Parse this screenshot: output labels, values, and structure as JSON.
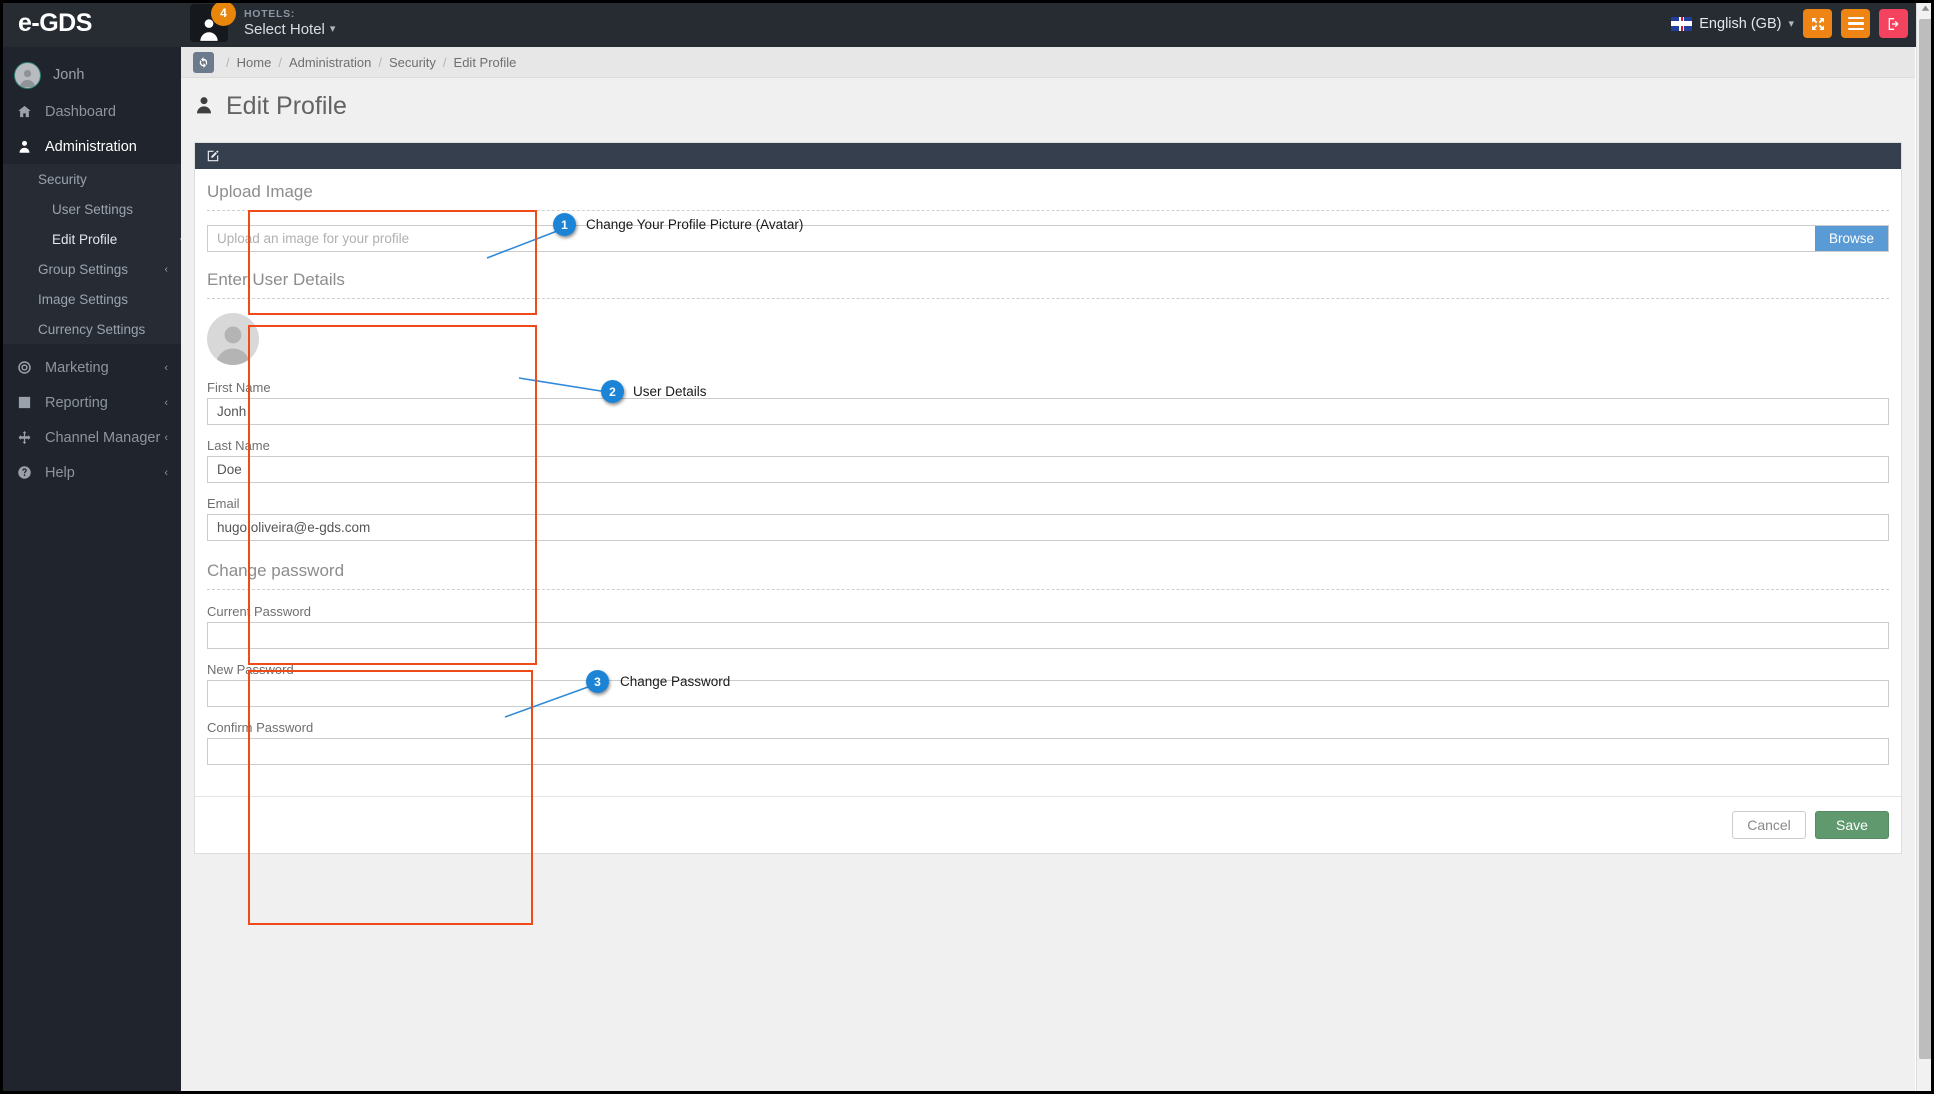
{
  "topbar": {
    "logo": "e-GDS",
    "notification_count": "4",
    "hotels_label": "HOTELS:",
    "hotel_select": "Select Hotel",
    "language": "English (GB)",
    "icons": {
      "hotel_avatar": "user-avatar-icon",
      "flag": "uk-flag-icon",
      "fullscreen": "fullscreen-icon",
      "menu": "hamburger-menu-icon",
      "logout": "logout-icon"
    },
    "colors": {
      "bar_bg": "#272c33",
      "badge": "#e8860c",
      "orange_btn": "#ee8413",
      "red_btn": "#f4435e"
    }
  },
  "sidebar": {
    "user": "Jonh",
    "items": [
      {
        "label": "Dashboard",
        "icon": "home-icon",
        "arrow": ""
      },
      {
        "label": "Administration",
        "icon": "user-icon",
        "arrow": "ⱟ"
      },
      {
        "label": "Marketing",
        "icon": "target-icon",
        "arrow": "‹"
      },
      {
        "label": "Reporting",
        "icon": "bar-chart-icon",
        "arrow": "‹"
      },
      {
        "label": "Channel Manager",
        "icon": "move-arrows-icon",
        "arrow": "‹"
      },
      {
        "label": "Help",
        "icon": "question-circle-icon",
        "arrow": "‹"
      }
    ],
    "submenu": [
      {
        "label": "Security",
        "arrow": "ⱟ",
        "level": 1
      },
      {
        "label": "User Settings",
        "arrow": "",
        "level": 2
      },
      {
        "label": "Edit Profile",
        "arrow": "",
        "level": 2
      },
      {
        "label": "Group Settings",
        "arrow": "‹",
        "level": 1
      },
      {
        "label": "Image Settings",
        "arrow": "",
        "level": 1
      },
      {
        "label": "Currency Settings",
        "arrow": "",
        "level": 1
      }
    ],
    "collapse_icon": "arrow-circle-left-icon"
  },
  "breadcrumb": {
    "refresh_icon": "refresh-icon",
    "items": [
      "Home",
      "Administration",
      "Security",
      "Edit Profile"
    ]
  },
  "page": {
    "title": "Edit Profile",
    "title_icon": "user-icon",
    "panel_icon": "edit-pencil-icon"
  },
  "upload": {
    "section_title": "Upload Image",
    "placeholder": "Upload an image for your profile",
    "value": "",
    "browse_label": "Browse",
    "browse_color": "#5b9bd5"
  },
  "user_details": {
    "section_title": "Enter User Details",
    "avatar_icon": "default-user-avatar-icon",
    "fields": [
      {
        "label": "First Name",
        "value": "Jonh"
      },
      {
        "label": "Last Name",
        "value": "Doe"
      },
      {
        "label": "Email",
        "value": "hugo.oliveira@e-gds.com"
      }
    ]
  },
  "change_password": {
    "section_title": "Change password",
    "fields": [
      {
        "label": "Current Password",
        "value": ""
      },
      {
        "label": "New Password",
        "value": ""
      },
      {
        "label": "Confirm Password",
        "value": ""
      }
    ]
  },
  "footer": {
    "cancel_label": "Cancel",
    "save_label": "Save",
    "save_color": "#60996e"
  },
  "annotations": [
    {
      "number": "1",
      "text": "Change Your Profile Picture (Avatar)"
    },
    {
      "number": "2",
      "text": "User Details"
    },
    {
      "number": "3",
      "text": "Change Password"
    }
  ],
  "annotation_colors": {
    "box": "#ef4a1a",
    "badge": "#1c84d6",
    "line": "#2e8ad8"
  }
}
